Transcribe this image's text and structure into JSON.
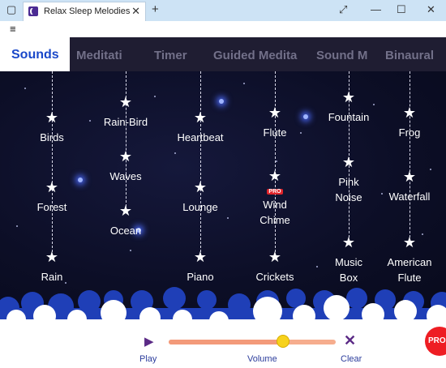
{
  "window": {
    "tab_title": "Relax Sleep Melodies",
    "new_tab_label": "+"
  },
  "menu": {
    "hamburger": "≡"
  },
  "tabs": [
    {
      "label": "Sounds",
      "active": true
    },
    {
      "label": "Meditati"
    },
    {
      "label": "Timer"
    },
    {
      "label": "Guided Medita"
    },
    {
      "label": "Sound M"
    },
    {
      "label": "Binaural"
    }
  ],
  "sounds": {
    "birds": "Birds",
    "forest": "Forest",
    "rain": "Rain",
    "rainbird": "Rain-Bird",
    "waves": "Waves",
    "ocean": "Ocean",
    "heartbeat": "Heartbeat",
    "lounge": "Lounge",
    "piano": "Piano",
    "flute": "Flute",
    "windchime_1": "Wind",
    "windchime_2": "Chime",
    "crickets": "Crickets",
    "fountain": "Fountain",
    "pinknoise_1": "Pink",
    "pinknoise_2": "Noise",
    "musicbox_1": "Music",
    "musicbox_2": "Box",
    "frog": "Frog",
    "waterfall": "Waterfall",
    "americanflute_1": "American",
    "americanflute_2": "Flute"
  },
  "pro_badge": "PRO",
  "player": {
    "play": "Play",
    "volume": "Volume",
    "clear": "Clear",
    "volume_level": 0.68,
    "pro": "PRO"
  },
  "colors": {
    "accent": "#1a48c9",
    "slider": "#f6ad8e",
    "thumb": "#f7d21c",
    "pro": "#ee1d23"
  }
}
